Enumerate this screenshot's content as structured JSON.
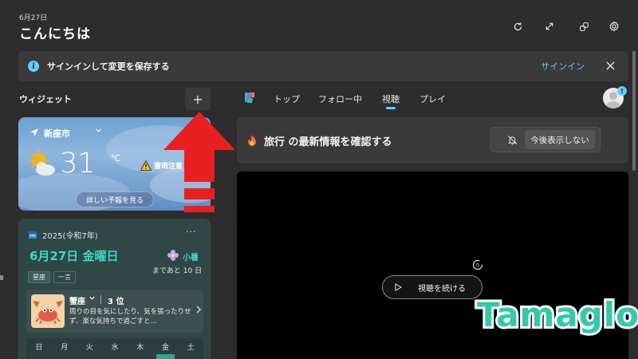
{
  "header": {
    "date": "6月27日",
    "greeting": "こんにちは",
    "icons": [
      "refresh-icon",
      "expand-icon",
      "link-icon",
      "settings-icon"
    ]
  },
  "signin": {
    "message": "サインインして変更を保存する",
    "link": "サインイン",
    "info_glyph": "i"
  },
  "widgets": {
    "title": "ウィジェット",
    "add_label": "+"
  },
  "weather": {
    "location": "新座市",
    "temperature": "31",
    "unit": "℃",
    "warning": "雷雨注意",
    "forecast_button": "詳しい予報を見る"
  },
  "calendar": {
    "year": "2025(令和7年)",
    "more": "···",
    "date": "6月27日 金曜日",
    "season": "小暑",
    "countdown": "まであと 10 日",
    "tabs": [
      "星座",
      "一言"
    ],
    "horoscope": {
      "sign": "蟹座",
      "rank": "3 位",
      "text": "周りの目を気にしたり、気を張ったりせず、楽な気持ちで過ごすと..."
    },
    "weekdays": [
      "日",
      "月",
      "火",
      "水",
      "木",
      "金",
      "土"
    ],
    "today_index": 5
  },
  "feed": {
    "tabs": [
      "トップ",
      "フォロー中",
      "視聴",
      "プレイ"
    ],
    "active_tab": "視聴",
    "profile_badge": "!"
  },
  "interest": {
    "text": "旅行 の最新情報を確認する",
    "hide_button": "今後表示しない"
  },
  "video": {
    "loader_text": "0",
    "continue_button": "視聴を続ける"
  },
  "watermark": "Tamaglo",
  "colors": {
    "background": "#2d2d2d",
    "accent": "#60cdff",
    "calendar_accent": "#3fd6c7",
    "annotation_arrow": "#e8201f",
    "watermark": "#33c9a9"
  }
}
